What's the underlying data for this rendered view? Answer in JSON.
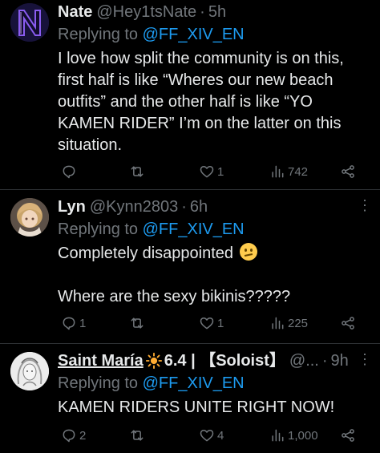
{
  "tweets": [
    {
      "name": "Nate",
      "handle": "@Hey1tsNate",
      "dot": "·",
      "time": "5h",
      "replying_prefix": "Replying to",
      "replying_to": "@FF_XIV_EN",
      "text": "I love how split the community is on this, first half is like “Wheres our new beach outfits” and the other half is like “YO KAMEN RIDER” I’m on the latter on this situation.",
      "replies": "",
      "retweets": "",
      "likes": "1",
      "views": "742"
    },
    {
      "name": "Lyn",
      "handle": "@Kynn2803",
      "dot": "·",
      "time": "6h",
      "replying_prefix": "Replying to",
      "replying_to": "@FF_XIV_EN",
      "text_line1": "Completely disappointed",
      "text_line2": "Where are the sexy bikinis?????",
      "replies": "1",
      "retweets": "",
      "likes": "1",
      "views": "225",
      "more": "⋮"
    },
    {
      "name_part1": "Saint María",
      "name_part2": "6.4 | 【Soloist】",
      "handle": "@...",
      "dot": "·",
      "time": "9h",
      "replying_prefix": "Replying to",
      "replying_to": "@FF_XIV_EN",
      "text": "KAMEN RIDERS UNITE RIGHT NOW!",
      "replies": "2",
      "retweets": "",
      "likes": "4",
      "views": "1,000",
      "more": "⋮"
    }
  ],
  "colors": {
    "background": "#000000",
    "text": "#e7e9ea",
    "muted": "#71767b",
    "link": "#1d9bf0",
    "divider": "#2f3336"
  },
  "icons": [
    "reply-icon",
    "retweet-icon",
    "like-icon",
    "views-icon",
    "share-icon",
    "more-icon",
    "disappointed-emoji-icon",
    "sun-emoji-icon"
  ]
}
